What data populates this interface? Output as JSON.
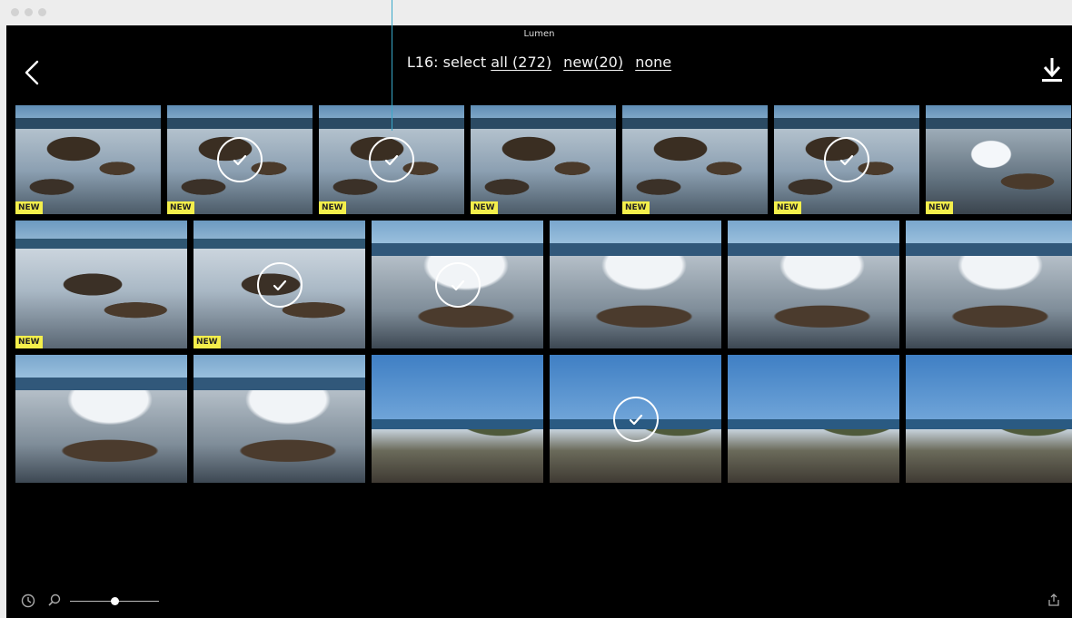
{
  "window": {
    "title": "Lumen"
  },
  "header": {
    "prefix": "L16: select",
    "all_link": "all (272)",
    "new_link": "new(20)",
    "none_link": "none"
  },
  "badge_label": "NEW",
  "icons": {
    "back": "chevron-left-icon",
    "download": "download-icon",
    "clock": "clock-icon",
    "zoom": "magnifier-icon",
    "share": "share-icon",
    "check": "checkmark-icon"
  },
  "zoom_slider": {
    "value_fraction": 0.5
  },
  "colors": {
    "badge": "#f4ef4b",
    "accent": "#39a8c9",
    "background": "#000000"
  },
  "rows": [
    {
      "thumbs": [
        {
          "scene": "blowhole",
          "new": true,
          "selected": false
        },
        {
          "scene": "blowhole",
          "new": true,
          "selected": true
        },
        {
          "scene": "blowhole",
          "new": true,
          "selected": true
        },
        {
          "scene": "blowhole",
          "new": true,
          "selected": false
        },
        {
          "scene": "blowhole",
          "new": true,
          "selected": false
        },
        {
          "scene": "blowhole",
          "new": true,
          "selected": true
        },
        {
          "scene": "splash",
          "new": true,
          "selected": false
        }
      ]
    },
    {
      "thumbs": [
        {
          "scene": "blowhole-wide",
          "new": true,
          "selected": false
        },
        {
          "scene": "blowhole-wide",
          "new": true,
          "selected": true
        },
        {
          "scene": "wave",
          "new": false,
          "selected": true
        },
        {
          "scene": "wave",
          "new": false,
          "selected": false
        },
        {
          "scene": "wave",
          "new": false,
          "selected": false
        },
        {
          "scene": "wave",
          "new": false,
          "selected": false
        }
      ]
    },
    {
      "thumbs": [
        {
          "scene": "wave",
          "new": false,
          "selected": false
        },
        {
          "scene": "wave",
          "new": false,
          "selected": false
        },
        {
          "scene": "headland",
          "new": false,
          "selected": false
        },
        {
          "scene": "headland",
          "new": false,
          "selected": true
        },
        {
          "scene": "headland",
          "new": false,
          "selected": false
        },
        {
          "scene": "headland",
          "new": false,
          "selected": false
        }
      ]
    }
  ]
}
